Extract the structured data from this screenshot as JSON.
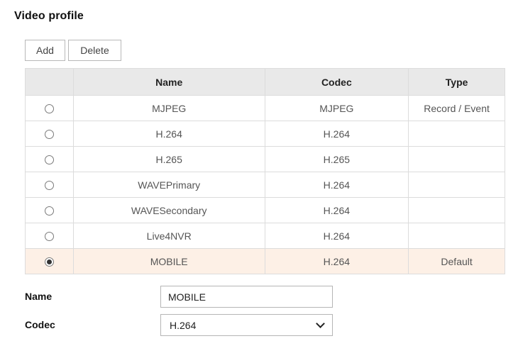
{
  "title": "Video profile",
  "toolbar": {
    "add_label": "Add",
    "delete_label": "Delete"
  },
  "table": {
    "headers": {
      "name": "Name",
      "codec": "Codec",
      "type": "Type"
    },
    "rows": [
      {
        "name": "MJPEG",
        "codec": "MJPEG",
        "type": "Record / Event",
        "selected": false
      },
      {
        "name": "H.264",
        "codec": "H.264",
        "type": "",
        "selected": false
      },
      {
        "name": "H.265",
        "codec": "H.265",
        "type": "",
        "selected": false
      },
      {
        "name": "WAVEPrimary",
        "codec": "H.264",
        "type": "",
        "selected": false
      },
      {
        "name": "WAVESecondary",
        "codec": "H.264",
        "type": "",
        "selected": false
      },
      {
        "name": "Live4NVR",
        "codec": "H.264",
        "type": "",
        "selected": false
      },
      {
        "name": "MOBILE",
        "codec": "H.264",
        "type": "Default",
        "selected": true
      }
    ],
    "selected_row_color": "#fdf0e6"
  },
  "form": {
    "name_label": "Name",
    "name_value": "MOBILE",
    "codec_label": "Codec",
    "codec_value": "H.264"
  }
}
